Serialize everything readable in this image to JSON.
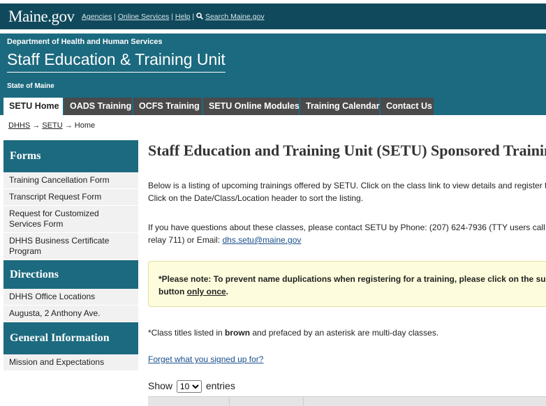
{
  "govbar": {
    "logo": "Maine.gov",
    "links": [
      "Agencies",
      "Online Services",
      "Help"
    ],
    "search_label": "Search Maine.gov"
  },
  "header": {
    "department": "Department of Health and Human Services",
    "title": "Staff Education & Training Unit",
    "state": "State of Maine"
  },
  "nav": {
    "tabs": [
      {
        "label": "SETU Home",
        "active": true
      },
      {
        "label": "OADS Training"
      },
      {
        "label": "OCFS Training"
      },
      {
        "label": "SETU Online Modules"
      },
      {
        "label": "Training Calendar"
      },
      {
        "label": "Contact Us"
      }
    ]
  },
  "breadcrumb": {
    "items": [
      "DHHS",
      "SETU",
      "Home"
    ],
    "separator": "→"
  },
  "sidebar": {
    "sections": [
      {
        "heading": "Forms",
        "items": [
          "Training Cancellation Form",
          "Transcript Request Form",
          "Request for Customized Services Form",
          "DHHS Business Certificate Program"
        ]
      },
      {
        "heading": "Directions",
        "items": [
          "DHHS Office Locations",
          "Augusta, 2 Anthony Ave."
        ]
      },
      {
        "heading": "General Information",
        "items": [
          "Mission and Expectations"
        ]
      }
    ]
  },
  "main": {
    "title": "Staff Education and Training Unit (SETU) Sponsored Training",
    "intro_line1": "Below is a listing of upcoming trainings offered by SETU. Click on the class link to view details and register for a",
    "intro_line2": "Click on the Date/Class/Location header to sort the listing.",
    "contact_line1": "If you have questions about these classes, please contact SETU by Phone: (207) 624-7936 (TTY users call Mai",
    "contact_line2_prefix": "relay 711) or Email: ",
    "contact_email": "dhs.setu@maine.gov",
    "notice_line1": "*Please note: To prevent name duplications when registering for a training, please click on the subm",
    "notice_line2_prefix": "button ",
    "notice_line2_emph": "only once",
    "notice_line2_suffix": ".",
    "class_note_prefix": "*Class titles listed in ",
    "class_note_emph": "brown",
    "class_note_suffix": " and prefaced by an asterisk are multi-day classes.",
    "forgot_link": "Forget what you signed up for?",
    "show_label": "Show",
    "show_value": "10",
    "entries_label": "entries"
  },
  "colors": {
    "gov_bar": "#10495c",
    "header": "#1c6a7f",
    "tab_dark": "#4a4a4a",
    "brown": "#8b3a06",
    "notice_bg": "#fdfcdc"
  }
}
